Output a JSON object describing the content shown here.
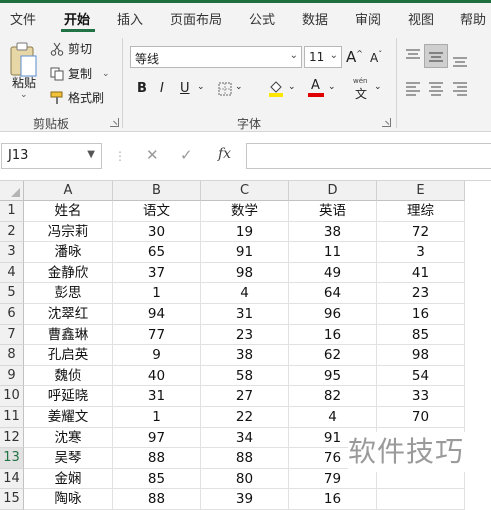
{
  "tabs": [
    {
      "label": "文件",
      "active": false
    },
    {
      "label": "开始",
      "active": true
    },
    {
      "label": "插入",
      "active": false
    },
    {
      "label": "页面布局",
      "active": false
    },
    {
      "label": "公式",
      "active": false
    },
    {
      "label": "数据",
      "active": false
    },
    {
      "label": "审阅",
      "active": false
    },
    {
      "label": "视图",
      "active": false
    },
    {
      "label": "帮助",
      "active": false
    }
  ],
  "clipboard": {
    "paste": "粘贴",
    "cut": "剪切",
    "copy": "复制",
    "format_painter": "格式刷",
    "group_label": "剪贴板"
  },
  "font": {
    "name": "等线",
    "size": "11",
    "grow": "A",
    "shrink": "A",
    "bold": "B",
    "italic": "I",
    "underline": "U",
    "wen": "wén",
    "wen_char": "文",
    "group_label": "字体"
  },
  "formula_bar": {
    "name_box": "J13",
    "cancel": "✕",
    "enter": "✓",
    "fx": "fx",
    "value": ""
  },
  "columns": [
    "A",
    "B",
    "C",
    "D",
    "E"
  ],
  "rows": [
    {
      "n": "1",
      "cells": [
        "姓名",
        "语文",
        "数学",
        "英语",
        "理综"
      ]
    },
    {
      "n": "2",
      "cells": [
        "冯宗莉",
        "30",
        "19",
        "38",
        "72"
      ]
    },
    {
      "n": "3",
      "cells": [
        "潘咏",
        "65",
        "91",
        "11",
        "3"
      ]
    },
    {
      "n": "4",
      "cells": [
        "金静欣",
        "37",
        "98",
        "49",
        "41"
      ]
    },
    {
      "n": "5",
      "cells": [
        "彭思",
        "1",
        "4",
        "64",
        "23"
      ]
    },
    {
      "n": "6",
      "cells": [
        "沈翠红",
        "94",
        "31",
        "96",
        "16"
      ]
    },
    {
      "n": "7",
      "cells": [
        "曹鑫琳",
        "77",
        "23",
        "16",
        "85"
      ]
    },
    {
      "n": "8",
      "cells": [
        "孔启英",
        "9",
        "38",
        "62",
        "98"
      ]
    },
    {
      "n": "9",
      "cells": [
        "魏侦",
        "40",
        "58",
        "95",
        "54"
      ]
    },
    {
      "n": "10",
      "cells": [
        "呼延晓",
        "31",
        "27",
        "82",
        "33"
      ]
    },
    {
      "n": "11",
      "cells": [
        "姜耀文",
        "1",
        "22",
        "4",
        "70"
      ]
    },
    {
      "n": "12",
      "cells": [
        "沈寒",
        "97",
        "34",
        "91",
        ""
      ]
    },
    {
      "n": "13",
      "cells": [
        "吴琴",
        "88",
        "88",
        "76",
        ""
      ]
    },
    {
      "n": "14",
      "cells": [
        "金娴",
        "85",
        "80",
        "79",
        ""
      ]
    },
    {
      "n": "15",
      "cells": [
        "陶咏",
        "88",
        "39",
        "16",
        ""
      ]
    }
  ],
  "watermark": "软件技巧",
  "colors": {
    "accent": "#217346",
    "ribbon_bg": "#f3f3f3"
  }
}
